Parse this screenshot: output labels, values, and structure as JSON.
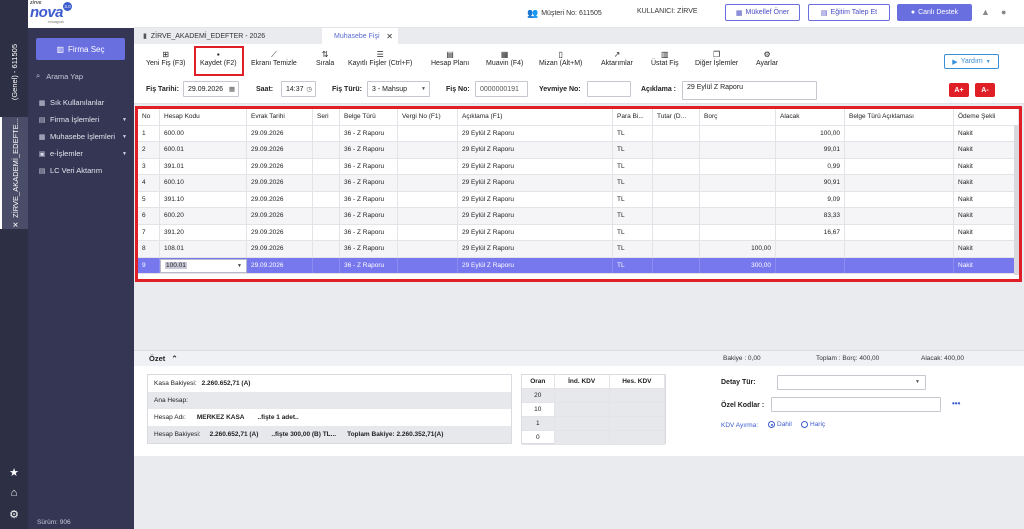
{
  "app": {
    "logo_small": "zirve",
    "logo_big": "nova",
    "logo_badge": "3.0",
    "logo_sub": "mimagcalı",
    "left_vtab1": "(Genel) - 611505",
    "left_vtab2": "ZİRVE_AKADEMİ_EDEFTE...",
    "version": "Sürüm: 906"
  },
  "sidebar": {
    "firma_sec": "Firma Seç",
    "search_placeholder": "Arama Yap",
    "items": [
      {
        "label": "Sık Kullanılanlar",
        "icon": "star",
        "has_chevron": false
      },
      {
        "label": "Firma İşlemleri",
        "icon": "building",
        "has_chevron": true
      },
      {
        "label": "Muhasebe İşlemleri",
        "icon": "calculator",
        "has_chevron": true
      },
      {
        "label": "e-İşlemler",
        "icon": "e-doc",
        "has_chevron": true
      },
      {
        "label": "LC Veri Aktarım",
        "icon": "transfer",
        "has_chevron": false
      }
    ]
  },
  "topbar": {
    "musteri": "Müşteri No: 611505",
    "kullanici": "KULLANICI: ZİRVE",
    "buttons": {
      "mukellef": "Mükellef Öner",
      "egitim": "Eğitim Talep Et",
      "canli": "Canlı Destek"
    }
  },
  "tabs": {
    "company_tab": "ZİRVE_AKADEMİ_EDEFTER - 2026",
    "active_tab": "Muhasebe Fişi"
  },
  "toolbar": {
    "items": [
      {
        "label": "Yeni Fiş (F3)",
        "icon": "plus-square-icon"
      },
      {
        "label": "Kaydet (F2)",
        "icon": "save-icon"
      },
      {
        "label": "Ekranı Temizle",
        "icon": "broom-icon"
      },
      {
        "label": "Sırala",
        "icon": "sort-icon"
      },
      {
        "label": "Kayıtlı Fişler (Ctrl+F)",
        "icon": "list-icon"
      },
      {
        "label": "Hesap Planı",
        "icon": "book-icon"
      },
      {
        "label": "Muavin (F4)",
        "icon": "ledger-icon"
      },
      {
        "label": "Mizan (Alt+M)",
        "icon": "doc-icon"
      },
      {
        "label": "Aktarımlar",
        "icon": "chart-icon"
      },
      {
        "label": "Üstat Fiş",
        "icon": "receipt-icon"
      },
      {
        "label": "Diğer İşlemler",
        "icon": "copy-icon"
      },
      {
        "label": "Ayarlar",
        "icon": "gear-icon"
      }
    ],
    "yardim": "Yardım"
  },
  "form": {
    "fis_tarihi_label": "Fiş Tarihi:",
    "fis_tarihi": "29.09.2026",
    "saat_label": "Saat:",
    "saat": "14:37",
    "fis_turu_label": "Fiş Türü:",
    "fis_turu": "3 - Mahsup",
    "fis_no_label": "Fiş No:",
    "fis_no": "0000000191",
    "yevmiye_label": "Yevmiye No:",
    "yevmiye": "",
    "aciklama_label": "Açıklama :",
    "aciklama": "29 Eylül Z Raporu",
    "font_plus": "A+",
    "font_minus": "A-"
  },
  "grid": {
    "columns": [
      "No",
      "Hesap Kodu",
      "Evrak Tarihi",
      "Seri",
      "Belge Türü",
      "Vergi No (F1)",
      "Açıklama (F1)",
      "Para Bi...",
      "Tutar (D...",
      "Borç",
      "Alacak",
      "Belge Türü Açıklaması",
      "Ödeme Şekli"
    ],
    "rows": [
      [
        "1",
        "600.00",
        "29.09.2026",
        "",
        "36 - Z Raporu",
        "",
        "29 Eylül Z Raporu",
        "TL",
        "",
        "",
        "100,00",
        "",
        "Nakit"
      ],
      [
        "2",
        "600.01",
        "29.09.2026",
        "",
        "36 - Z Raporu",
        "",
        "29 Eylül Z Raporu",
        "TL",
        "",
        "",
        "99,01",
        "",
        "Nakit"
      ],
      [
        "3",
        "391.01",
        "29.09.2026",
        "",
        "36 - Z Raporu",
        "",
        "29 Eylül Z Raporu",
        "TL",
        "",
        "",
        "0,99",
        "",
        "Nakit"
      ],
      [
        "4",
        "600.10",
        "29.09.2026",
        "",
        "36 - Z Raporu",
        "",
        "29 Eylül Z Raporu",
        "TL",
        "",
        "",
        "90,91",
        "",
        "Nakit"
      ],
      [
        "5",
        "391.10",
        "29.09.2026",
        "",
        "36 - Z Raporu",
        "",
        "29 Eylül Z Raporu",
        "TL",
        "",
        "",
        "9,09",
        "",
        "Nakit"
      ],
      [
        "6",
        "600.20",
        "29.09.2026",
        "",
        "36 - Z Raporu",
        "",
        "29 Eylül Z Raporu",
        "TL",
        "",
        "",
        "83,33",
        "",
        "Nakit"
      ],
      [
        "7",
        "391.20",
        "29.09.2026",
        "",
        "36 - Z Raporu",
        "",
        "29 Eylül Z Raporu",
        "TL",
        "",
        "",
        "16,67",
        "",
        "Nakit"
      ],
      [
        "8",
        "108.01",
        "29.09.2026",
        "",
        "36 - Z Raporu",
        "",
        "29 Eylül Z Raporu",
        "TL",
        "",
        "100,00",
        "",
        "",
        "Nakit"
      ],
      [
        "9",
        "100.01",
        "29.09.2026",
        "",
        "36 - Z Raporu",
        "",
        "29 Eylül Z Raporu",
        "TL",
        "",
        "300,00",
        "",
        "",
        "Nakit"
      ]
    ],
    "selected_row": 8
  },
  "ozet": {
    "title": "Özet",
    "bakiye": "Bakiye : 0,00",
    "toplam": "Toplam : Borç: 400,00",
    "alacak": "Alacak: 400,00",
    "kasa": {
      "kasa_bakiyesi_label": "Kasa Bakiyesi:",
      "kasa_bakiyesi": "2.260.652,71 (A)",
      "ana_hesap_label": "Ana Hesap:",
      "hesap_adi_label": "Hesap Adı:",
      "hesap_adi": "MERKEZ KASA",
      "fiste_adet": "..fişte 1 adet..",
      "hesap_bakiyesi_label": "Hesap Bakiyesi:",
      "hesap_bakiyesi": "2.260.652,71 (A)",
      "fiste_tutar": "..fişte 300,00 (B) TL...",
      "toplam_bakiye": "Toplam Bakiye: 2.260.352,71(A)"
    },
    "oran": {
      "headers": [
        "Oran",
        "İnd. KDV",
        "Hes. KDV"
      ],
      "rows": [
        "20",
        "10",
        "1",
        "0"
      ]
    },
    "detay_turu_label": "Detay Tür:",
    "ozel_kodlar_label": "Özel Kodlar :",
    "kdv_ayirma_label": "KDV Ayırma:",
    "kdv_dahil": "Dahil",
    "kdv_haric": "Hariç"
  }
}
